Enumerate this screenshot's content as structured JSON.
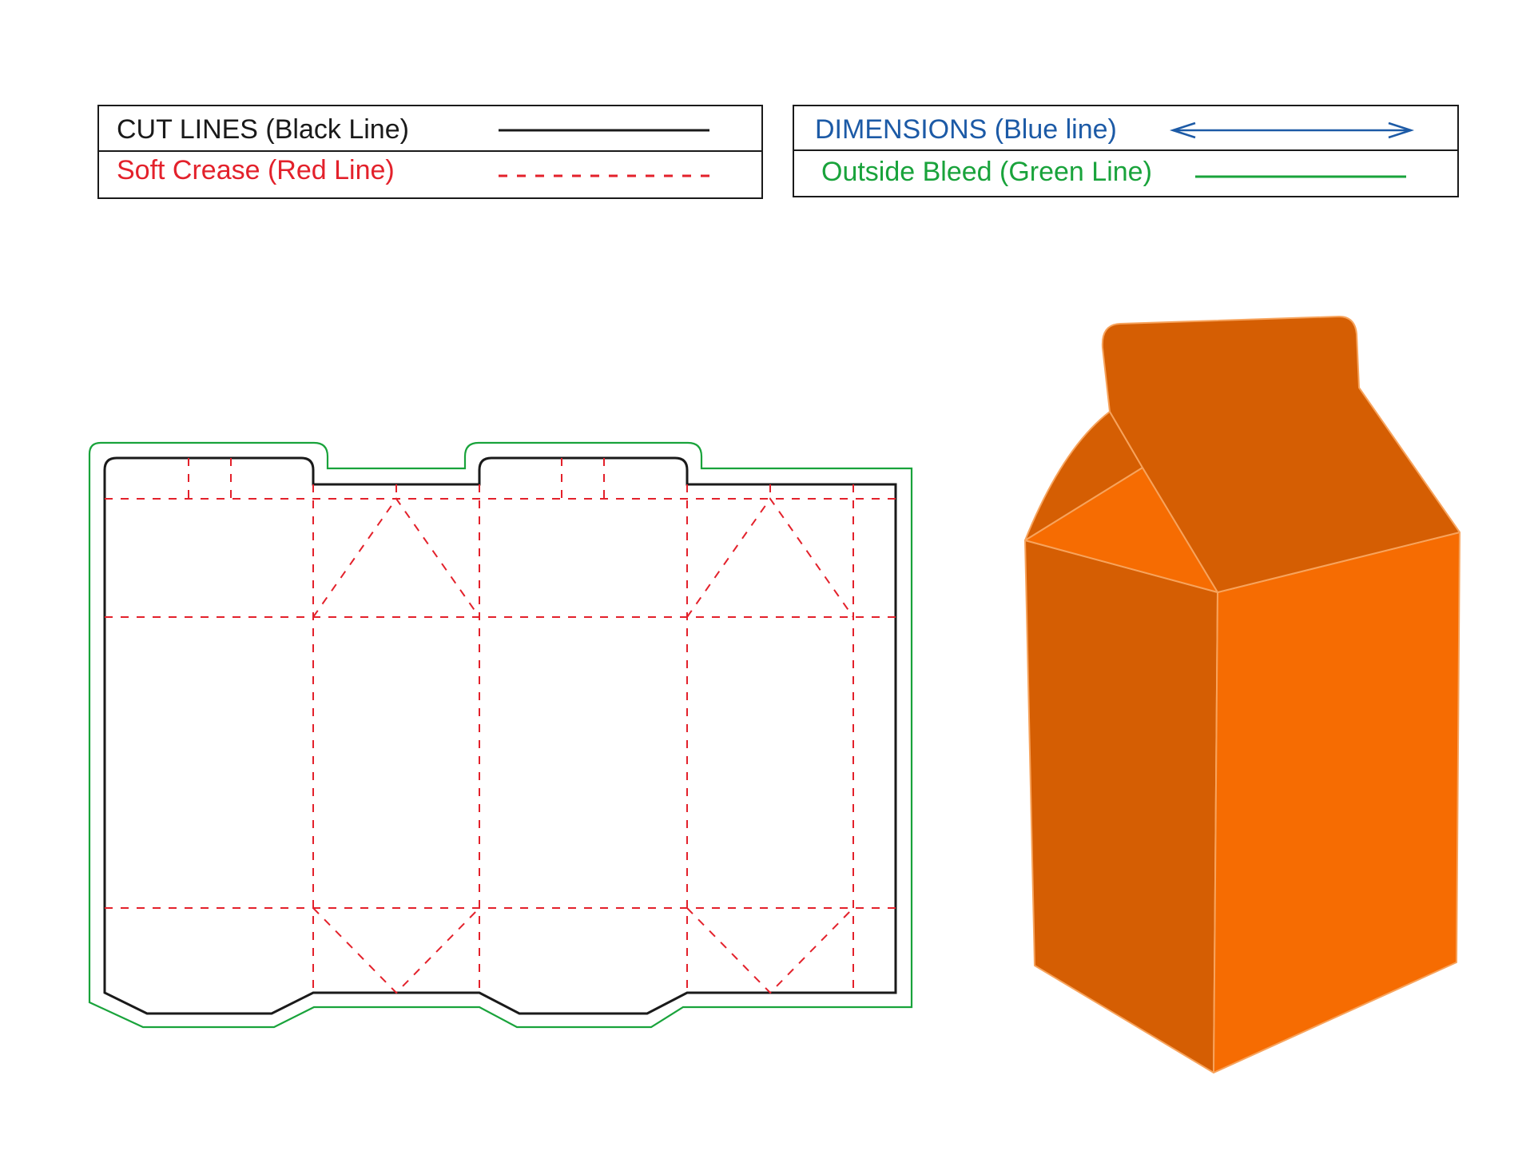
{
  "legend": {
    "cut": {
      "label": "CUT LINES (Black Line)",
      "color": "#1a1a1a"
    },
    "crease": {
      "label": "Soft Crease (Red Line)",
      "color": "#e3212b"
    },
    "dimensions": {
      "label": "DIMENSIONS (Blue line)",
      "color": "#1c5aa6"
    },
    "bleed": {
      "label": "Outside Bleed (Green Line)",
      "color": "#19a33b"
    }
  },
  "carton": {
    "dark_face_color": "#d55e03",
    "light_face_color": "#f66c02",
    "edge_color": "#f7a35c"
  }
}
